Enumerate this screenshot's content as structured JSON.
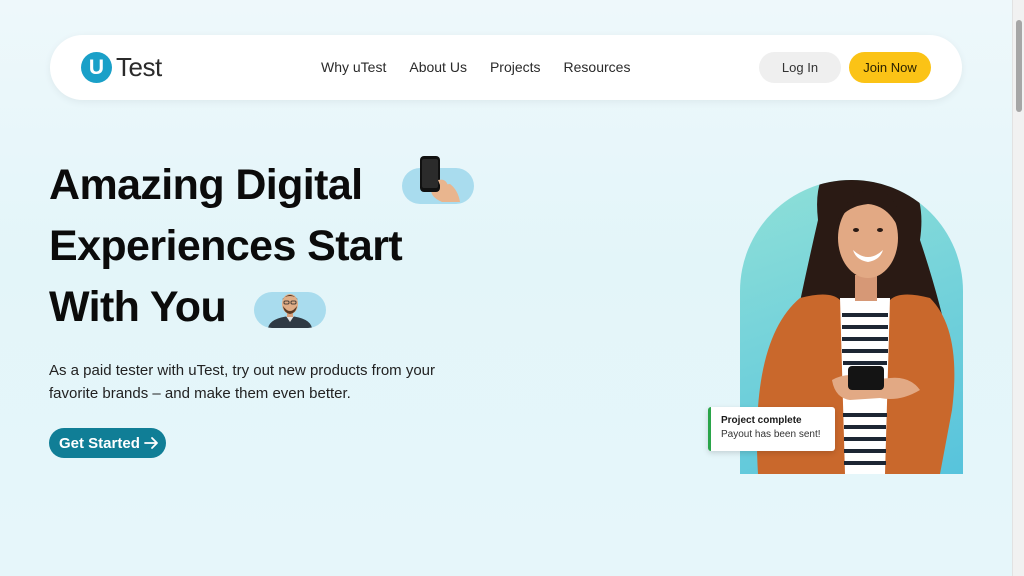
{
  "brand": {
    "mark": "U",
    "name": "Test",
    "accent": "#1aa0c8"
  },
  "nav": {
    "links": [
      "Why uTest",
      "About Us",
      "Projects",
      "Resources"
    ],
    "login_label": "Log In",
    "join_label": "Join Now"
  },
  "hero": {
    "headline_line1": "Amazing Digital",
    "headline_line2": "Experiences Start",
    "headline_line3": "With You",
    "subtext": "As a paid tester with uTest, try out new products from your favorite brands – and make them even better.",
    "cta_label": "Get Started"
  },
  "toast": {
    "title": "Project complete",
    "body": "Payout has been sent!"
  },
  "colors": {
    "join_button": "#fbc316",
    "cta_button": "#107e96",
    "toast_accent": "#2aa54a"
  }
}
